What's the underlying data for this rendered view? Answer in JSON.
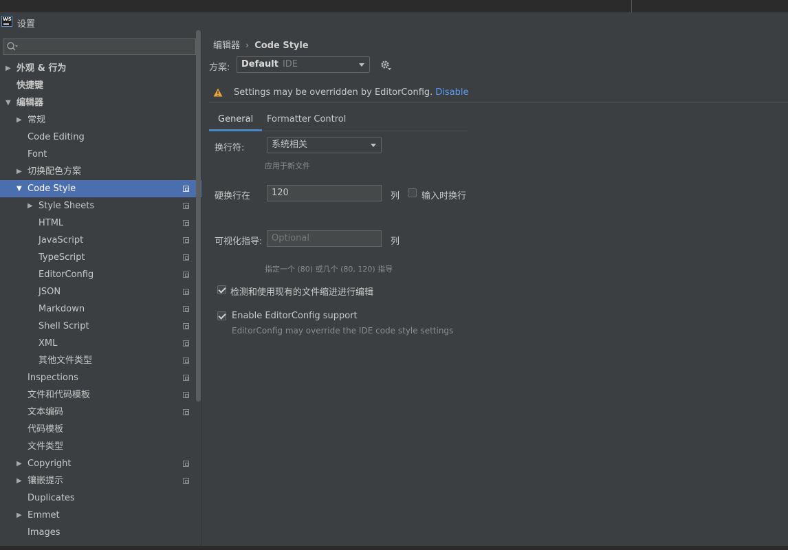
{
  "window": {
    "title": "设置",
    "app_icon_text": "WS"
  },
  "search": {
    "placeholder": ""
  },
  "sidebar": {
    "items": [
      {
        "label": "外观 & 行为",
        "level": 0,
        "arrow": "right",
        "bold": true,
        "copy": false,
        "selected": false
      },
      {
        "label": "快捷键",
        "level": 0,
        "arrow": "none",
        "bold": true,
        "copy": false,
        "selected": false
      },
      {
        "label": "编辑器",
        "level": 0,
        "arrow": "down",
        "bold": true,
        "copy": false,
        "selected": false
      },
      {
        "label": "常规",
        "level": 1,
        "arrow": "right",
        "bold": false,
        "copy": false,
        "selected": false
      },
      {
        "label": "Code Editing",
        "level": 1,
        "arrow": "none",
        "bold": false,
        "copy": false,
        "selected": false
      },
      {
        "label": "Font",
        "level": 1,
        "arrow": "none",
        "bold": false,
        "copy": false,
        "selected": false
      },
      {
        "label": "切换配色方案",
        "level": 1,
        "arrow": "right",
        "bold": false,
        "copy": false,
        "selected": false
      },
      {
        "label": "Code Style",
        "level": 1,
        "arrow": "down",
        "bold": false,
        "copy": true,
        "selected": true
      },
      {
        "label": "Style Sheets",
        "level": 2,
        "arrow": "right",
        "bold": false,
        "copy": true,
        "selected": false
      },
      {
        "label": "HTML",
        "level": 2,
        "arrow": "none",
        "bold": false,
        "copy": true,
        "selected": false
      },
      {
        "label": "JavaScript",
        "level": 2,
        "arrow": "none",
        "bold": false,
        "copy": true,
        "selected": false
      },
      {
        "label": "TypeScript",
        "level": 2,
        "arrow": "none",
        "bold": false,
        "copy": true,
        "selected": false
      },
      {
        "label": "EditorConfig",
        "level": 2,
        "arrow": "none",
        "bold": false,
        "copy": true,
        "selected": false
      },
      {
        "label": "JSON",
        "level": 2,
        "arrow": "none",
        "bold": false,
        "copy": true,
        "selected": false
      },
      {
        "label": "Markdown",
        "level": 2,
        "arrow": "none",
        "bold": false,
        "copy": true,
        "selected": false
      },
      {
        "label": "Shell Script",
        "level": 2,
        "arrow": "none",
        "bold": false,
        "copy": true,
        "selected": false
      },
      {
        "label": "XML",
        "level": 2,
        "arrow": "none",
        "bold": false,
        "copy": true,
        "selected": false
      },
      {
        "label": "其他文件类型",
        "level": 2,
        "arrow": "none",
        "bold": false,
        "copy": true,
        "selected": false
      },
      {
        "label": "Inspections",
        "level": 1,
        "arrow": "none",
        "bold": false,
        "copy": true,
        "selected": false
      },
      {
        "label": "文件和代码模板",
        "level": 1,
        "arrow": "none",
        "bold": false,
        "copy": true,
        "selected": false
      },
      {
        "label": "文本编码",
        "level": 1,
        "arrow": "none",
        "bold": false,
        "copy": true,
        "selected": false
      },
      {
        "label": "代码模板",
        "level": 1,
        "arrow": "none",
        "bold": false,
        "copy": false,
        "selected": false
      },
      {
        "label": "文件类型",
        "level": 1,
        "arrow": "none",
        "bold": false,
        "copy": false,
        "selected": false
      },
      {
        "label": "Copyright",
        "level": 1,
        "arrow": "right",
        "bold": false,
        "copy": true,
        "selected": false
      },
      {
        "label": "镶嵌提示",
        "level": 1,
        "arrow": "right",
        "bold": false,
        "copy": true,
        "selected": false
      },
      {
        "label": "Duplicates",
        "level": 1,
        "arrow": "none",
        "bold": false,
        "copy": false,
        "selected": false
      },
      {
        "label": "Emmet",
        "level": 1,
        "arrow": "right",
        "bold": false,
        "copy": false,
        "selected": false
      },
      {
        "label": "Images",
        "level": 1,
        "arrow": "none",
        "bold": false,
        "copy": false,
        "selected": false
      }
    ]
  },
  "breadcrumb": {
    "parent": "编辑器",
    "separator": "›",
    "current": "Code Style"
  },
  "scheme": {
    "label": "方案:",
    "name": "Default",
    "type": "IDE"
  },
  "warning": {
    "text": "Settings may be overridden by EditorConfig.",
    "link": "Disable"
  },
  "tabs": [
    {
      "label": "General",
      "active": true
    },
    {
      "label": "Formatter Control",
      "active": false
    }
  ],
  "general": {
    "line_separator_label": "换行符:",
    "line_separator_value": "系统相关",
    "line_separator_hint": "应用于新文件",
    "hard_wrap_label": "硬换行在",
    "hard_wrap_value": "120",
    "hard_wrap_unit": "列",
    "wrap_on_typing_label": "输入时换行",
    "wrap_on_typing_checked": false,
    "visual_guides_label": "可视化指导:",
    "visual_guides_placeholder": "Optional",
    "visual_guides_unit": "列",
    "visual_guides_hint": "指定一个 (80) 或几个 (80, 120) 指导",
    "detect_indent_label": "检测和使用现有的文件缩进进行编辑",
    "detect_indent_checked": true,
    "editorconfig_label": "Enable EditorConfig support",
    "editorconfig_checked": true,
    "editorconfig_hint": "EditorConfig may override the IDE code style settings"
  },
  "colors": {
    "selection": "#4b6eaf",
    "link": "#589df6",
    "tab_underline": "#4a88c7",
    "warning": "#e8a33a"
  }
}
